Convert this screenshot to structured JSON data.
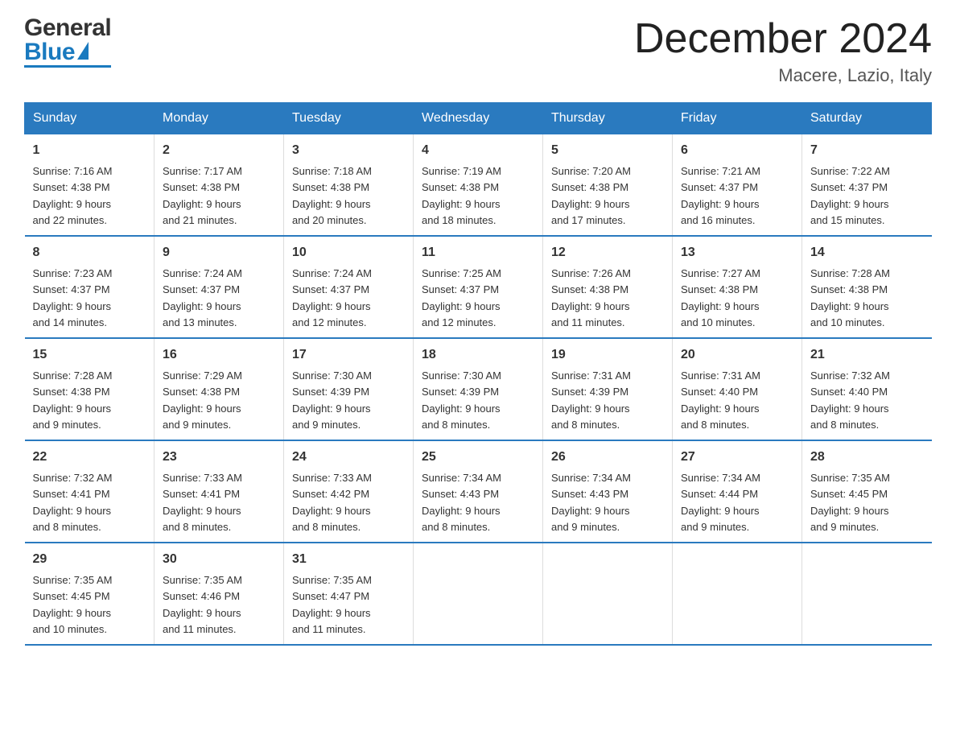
{
  "header": {
    "logo": {
      "general_text": "General",
      "blue_text": "Blue"
    },
    "month_title": "December 2024",
    "location": "Macere, Lazio, Italy"
  },
  "weekdays": [
    "Sunday",
    "Monday",
    "Tuesday",
    "Wednesday",
    "Thursday",
    "Friday",
    "Saturday"
  ],
  "weeks": [
    [
      {
        "day": "1",
        "sunrise": "7:16 AM",
        "sunset": "4:38 PM",
        "daylight": "9 hours and 22 minutes."
      },
      {
        "day": "2",
        "sunrise": "7:17 AM",
        "sunset": "4:38 PM",
        "daylight": "9 hours and 21 minutes."
      },
      {
        "day": "3",
        "sunrise": "7:18 AM",
        "sunset": "4:38 PM",
        "daylight": "9 hours and 20 minutes."
      },
      {
        "day": "4",
        "sunrise": "7:19 AM",
        "sunset": "4:38 PM",
        "daylight": "9 hours and 18 minutes."
      },
      {
        "day": "5",
        "sunrise": "7:20 AM",
        "sunset": "4:38 PM",
        "daylight": "9 hours and 17 minutes."
      },
      {
        "day": "6",
        "sunrise": "7:21 AM",
        "sunset": "4:37 PM",
        "daylight": "9 hours and 16 minutes."
      },
      {
        "day": "7",
        "sunrise": "7:22 AM",
        "sunset": "4:37 PM",
        "daylight": "9 hours and 15 minutes."
      }
    ],
    [
      {
        "day": "8",
        "sunrise": "7:23 AM",
        "sunset": "4:37 PM",
        "daylight": "9 hours and 14 minutes."
      },
      {
        "day": "9",
        "sunrise": "7:24 AM",
        "sunset": "4:37 PM",
        "daylight": "9 hours and 13 minutes."
      },
      {
        "day": "10",
        "sunrise": "7:24 AM",
        "sunset": "4:37 PM",
        "daylight": "9 hours and 12 minutes."
      },
      {
        "day": "11",
        "sunrise": "7:25 AM",
        "sunset": "4:37 PM",
        "daylight": "9 hours and 12 minutes."
      },
      {
        "day": "12",
        "sunrise": "7:26 AM",
        "sunset": "4:38 PM",
        "daylight": "9 hours and 11 minutes."
      },
      {
        "day": "13",
        "sunrise": "7:27 AM",
        "sunset": "4:38 PM",
        "daylight": "9 hours and 10 minutes."
      },
      {
        "day": "14",
        "sunrise": "7:28 AM",
        "sunset": "4:38 PM",
        "daylight": "9 hours and 10 minutes."
      }
    ],
    [
      {
        "day": "15",
        "sunrise": "7:28 AM",
        "sunset": "4:38 PM",
        "daylight": "9 hours and 9 minutes."
      },
      {
        "day": "16",
        "sunrise": "7:29 AM",
        "sunset": "4:38 PM",
        "daylight": "9 hours and 9 minutes."
      },
      {
        "day": "17",
        "sunrise": "7:30 AM",
        "sunset": "4:39 PM",
        "daylight": "9 hours and 9 minutes."
      },
      {
        "day": "18",
        "sunrise": "7:30 AM",
        "sunset": "4:39 PM",
        "daylight": "9 hours and 8 minutes."
      },
      {
        "day": "19",
        "sunrise": "7:31 AM",
        "sunset": "4:39 PM",
        "daylight": "9 hours and 8 minutes."
      },
      {
        "day": "20",
        "sunrise": "7:31 AM",
        "sunset": "4:40 PM",
        "daylight": "9 hours and 8 minutes."
      },
      {
        "day": "21",
        "sunrise": "7:32 AM",
        "sunset": "4:40 PM",
        "daylight": "9 hours and 8 minutes."
      }
    ],
    [
      {
        "day": "22",
        "sunrise": "7:32 AM",
        "sunset": "4:41 PM",
        "daylight": "9 hours and 8 minutes."
      },
      {
        "day": "23",
        "sunrise": "7:33 AM",
        "sunset": "4:41 PM",
        "daylight": "9 hours and 8 minutes."
      },
      {
        "day": "24",
        "sunrise": "7:33 AM",
        "sunset": "4:42 PM",
        "daylight": "9 hours and 8 minutes."
      },
      {
        "day": "25",
        "sunrise": "7:34 AM",
        "sunset": "4:43 PM",
        "daylight": "9 hours and 8 minutes."
      },
      {
        "day": "26",
        "sunrise": "7:34 AM",
        "sunset": "4:43 PM",
        "daylight": "9 hours and 9 minutes."
      },
      {
        "day": "27",
        "sunrise": "7:34 AM",
        "sunset": "4:44 PM",
        "daylight": "9 hours and 9 minutes."
      },
      {
        "day": "28",
        "sunrise": "7:35 AM",
        "sunset": "4:45 PM",
        "daylight": "9 hours and 9 minutes."
      }
    ],
    [
      {
        "day": "29",
        "sunrise": "7:35 AM",
        "sunset": "4:45 PM",
        "daylight": "9 hours and 10 minutes."
      },
      {
        "day": "30",
        "sunrise": "7:35 AM",
        "sunset": "4:46 PM",
        "daylight": "9 hours and 11 minutes."
      },
      {
        "day": "31",
        "sunrise": "7:35 AM",
        "sunset": "4:47 PM",
        "daylight": "9 hours and 11 minutes."
      },
      null,
      null,
      null,
      null
    ]
  ],
  "labels": {
    "sunrise": "Sunrise:",
    "sunset": "Sunset:",
    "daylight": "Daylight:"
  }
}
